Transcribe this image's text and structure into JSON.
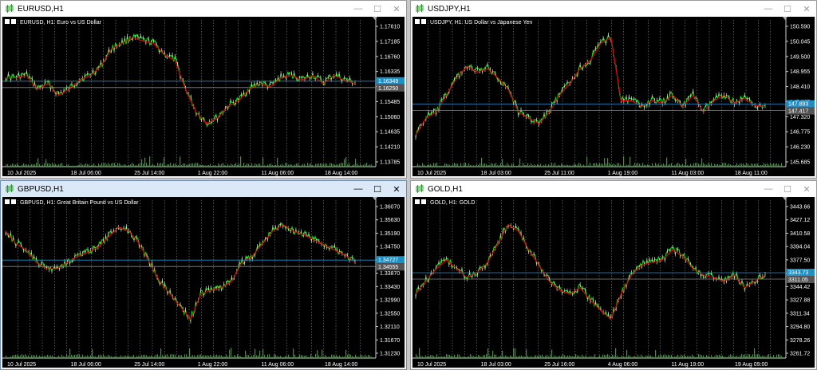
{
  "windows": [
    {
      "id": "eurusd",
      "title": "EURUSD,H1",
      "header_label": "EURUSD,  H1:  Euro vs US Dollar",
      "active": false,
      "price_labels": [
        "1.17610",
        "1.17185",
        "1.16760",
        "1.16335",
        "1.15910",
        "1.15485",
        "1.15060",
        "1.14635",
        "1.14210",
        "1.13785"
      ],
      "date_labels": [
        "10 Jul 2025",
        "18 Jul 06:00",
        "25 Jul 14:00",
        "1 Aug 22:00",
        "11 Aug 06:00",
        "18 Aug 14:00"
      ],
      "current_bid": "1.16349",
      "current_ask": "1.16250",
      "highlight_color": "#1e90c8",
      "path_points": [
        0.6,
        0.6,
        0.62,
        0.5,
        0.55,
        0.45,
        0.5,
        0.58,
        0.62,
        0.7,
        0.85,
        0.9,
        0.95,
        0.92,
        0.9,
        0.8,
        0.75,
        0.5,
        0.3,
        0.2,
        0.25,
        0.35,
        0.4,
        0.5,
        0.55,
        0.52,
        0.6,
        0.62,
        0.58,
        0.62,
        0.55,
        0.62,
        0.58,
        0.55
      ]
    },
    {
      "id": "usdjpy",
      "title": "USDJPY,H1",
      "header_label": "USDJPY,  H1:  US Dollar vs Japanese Yen",
      "active": false,
      "price_labels": [
        "150.590",
        "150.045",
        "149.500",
        "148.955",
        "148.410",
        "147.865",
        "147.320",
        "146.775",
        "146.230",
        "145.685"
      ],
      "date_labels": [
        "10 Jul 2025",
        "18 Jul 03:00",
        "25 Jul 11:00",
        "1 Aug 19:00",
        "11 Aug 03:00",
        "18 Aug 11:00"
      ],
      "current_bid": "147.893",
      "current_ask": "147.417",
      "highlight_color": "#1e90c8",
      "path_points": [
        0.1,
        0.25,
        0.3,
        0.45,
        0.6,
        0.7,
        0.65,
        0.68,
        0.6,
        0.5,
        0.3,
        0.25,
        0.2,
        0.3,
        0.45,
        0.55,
        0.68,
        0.75,
        0.9,
        0.95,
        0.4,
        0.4,
        0.35,
        0.4,
        0.38,
        0.45,
        0.35,
        0.45,
        0.3,
        0.4,
        0.45,
        0.38,
        0.42,
        0.36,
        0.35
      ]
    },
    {
      "id": "gbpusd",
      "title": "GBPUSD,H1",
      "header_label": "GBPUSD,  H1:  Great Britain Pound vs US Dollar",
      "active": true,
      "price_labels": [
        "1.36070",
        "1.35630",
        "1.35190",
        "1.34750",
        "1.34310",
        "1.33870",
        "1.33430",
        "1.32990",
        "1.32550",
        "1.32110",
        "1.31670",
        "1.31230"
      ],
      "date_labels": [
        "10 Jul 2025",
        "18 Jul 06:00",
        "25 Jul 14:00",
        "1 Aug 22:00",
        "11 Aug 06:00",
        "18 Aug 14:00"
      ],
      "current_bid": "1.34727",
      "current_ask": "1.34555",
      "highlight_color": "#1e90c8",
      "path_points": [
        0.85,
        0.75,
        0.7,
        0.6,
        0.55,
        0.55,
        0.6,
        0.65,
        0.68,
        0.72,
        0.8,
        0.88,
        0.85,
        0.75,
        0.6,
        0.45,
        0.35,
        0.25,
        0.15,
        0.35,
        0.38,
        0.4,
        0.45,
        0.6,
        0.65,
        0.75,
        0.85,
        0.9,
        0.85,
        0.82,
        0.78,
        0.74,
        0.7,
        0.66,
        0.6
      ]
    },
    {
      "id": "gold",
      "title": "GOLD,H1",
      "header_label": "GOLD,  H1:  GOLD",
      "active": false,
      "price_labels": [
        "3443.66",
        "3427.12",
        "3410.58",
        "3394.04",
        "3377.50",
        "3360.96",
        "3344.42",
        "3327.88",
        "3311.34",
        "3294.80",
        "3278.26",
        "3261.72"
      ],
      "date_labels": [
        "10 Jul 2025",
        "18 Jul 03:00",
        "25 Jul 16:00",
        "4 Aug 06:00",
        "11 Aug 19:00",
        "19 Aug 09:00"
      ],
      "current_bid": "3343.73",
      "current_ask": "3311.05",
      "highlight_color": "#1e90c8",
      "path_points": [
        0.35,
        0.45,
        0.55,
        0.62,
        0.55,
        0.48,
        0.52,
        0.6,
        0.75,
        0.9,
        0.85,
        0.7,
        0.58,
        0.45,
        0.38,
        0.35,
        0.4,
        0.3,
        0.22,
        0.15,
        0.35,
        0.5,
        0.58,
        0.6,
        0.62,
        0.7,
        0.65,
        0.55,
        0.5,
        0.48,
        0.45,
        0.5,
        0.4,
        0.45,
        0.5
      ]
    }
  ]
}
